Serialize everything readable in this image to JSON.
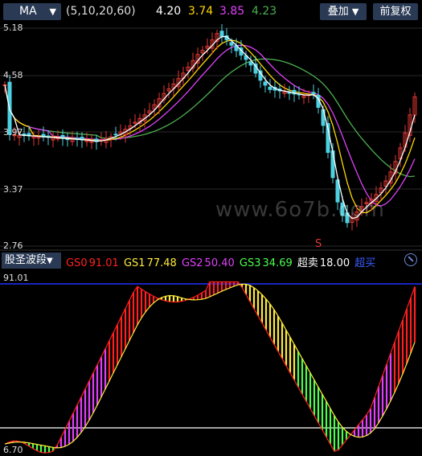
{
  "toolbar": {
    "indicator": "MA",
    "params": "(5,10,20,60)",
    "ma5": "4.20",
    "ma10": "3.74",
    "ma20": "3.85",
    "ma60": "4.23",
    "overlay_label": "叠加",
    "adjust_label": "前复权"
  },
  "colors": {
    "ma5": "#ffffff",
    "ma10": "#ffd700",
    "ma20": "#e040fb",
    "ma60": "#4caf50",
    "up": "#e53935",
    "down": "#4dd0e1",
    "gs0": "#ff2020",
    "gs1": "#ffeb3b",
    "gs2": "#e040fb",
    "gs3": "#4cff4c",
    "oversold": "#ffffff",
    "top_line": "#2030ff"
  },
  "price_axis": [
    "5.18",
    "4.58",
    "3.97",
    "3.37",
    "2.76"
  ],
  "sell_marker": "S",
  "watermark": "www.6o7b.com",
  "indicator_bar": {
    "name": "股圣波段",
    "gs0_label": "GS0",
    "gs0": "91.01",
    "gs1_label": "GS1",
    "gs1": "77.48",
    "gs2_label": "GS2",
    "gs2": "50.40",
    "gs3_label": "GS3",
    "gs3": "34.69",
    "oversold_label": "超卖",
    "oversold": "18.00",
    "extra_label": "超买"
  },
  "indicator_axis": {
    "top": "91.01",
    "bottom": "6.70"
  }
}
